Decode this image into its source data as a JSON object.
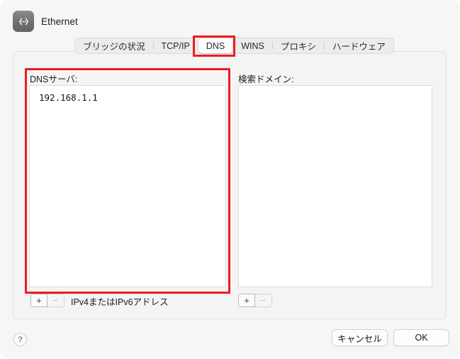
{
  "window": {
    "title": "Ethernet",
    "icon": "ethernet-icon"
  },
  "tabs": [
    {
      "label": "ブリッジの状況",
      "selected": false,
      "name": "tab-bridge-status"
    },
    {
      "label": "TCP/IP",
      "selected": false,
      "name": "tab-tcpip"
    },
    {
      "label": "DNS",
      "selected": true,
      "name": "tab-dns"
    },
    {
      "label": "WINS",
      "selected": false,
      "name": "tab-wins"
    },
    {
      "label": "プロキシ",
      "selected": false,
      "name": "tab-proxies"
    },
    {
      "label": "ハードウェア",
      "selected": false,
      "name": "tab-hardware"
    }
  ],
  "dns_servers": {
    "label": "DNSサーバ:",
    "items": [
      "192.168.1.1"
    ],
    "add_label": "+",
    "remove_label": "−",
    "hint": "IPv4またはIPv6アドレス"
  },
  "search_domains": {
    "label": "検索ドメイン:",
    "items": [],
    "add_label": "+",
    "remove_label": "−"
  },
  "footer": {
    "help_label": "?",
    "cancel_label": "キャンセル",
    "ok_label": "OK"
  },
  "annotations": {
    "highlight_color": "#ec1c24",
    "boxes": [
      "dns-tab",
      "dns-server-list"
    ]
  }
}
